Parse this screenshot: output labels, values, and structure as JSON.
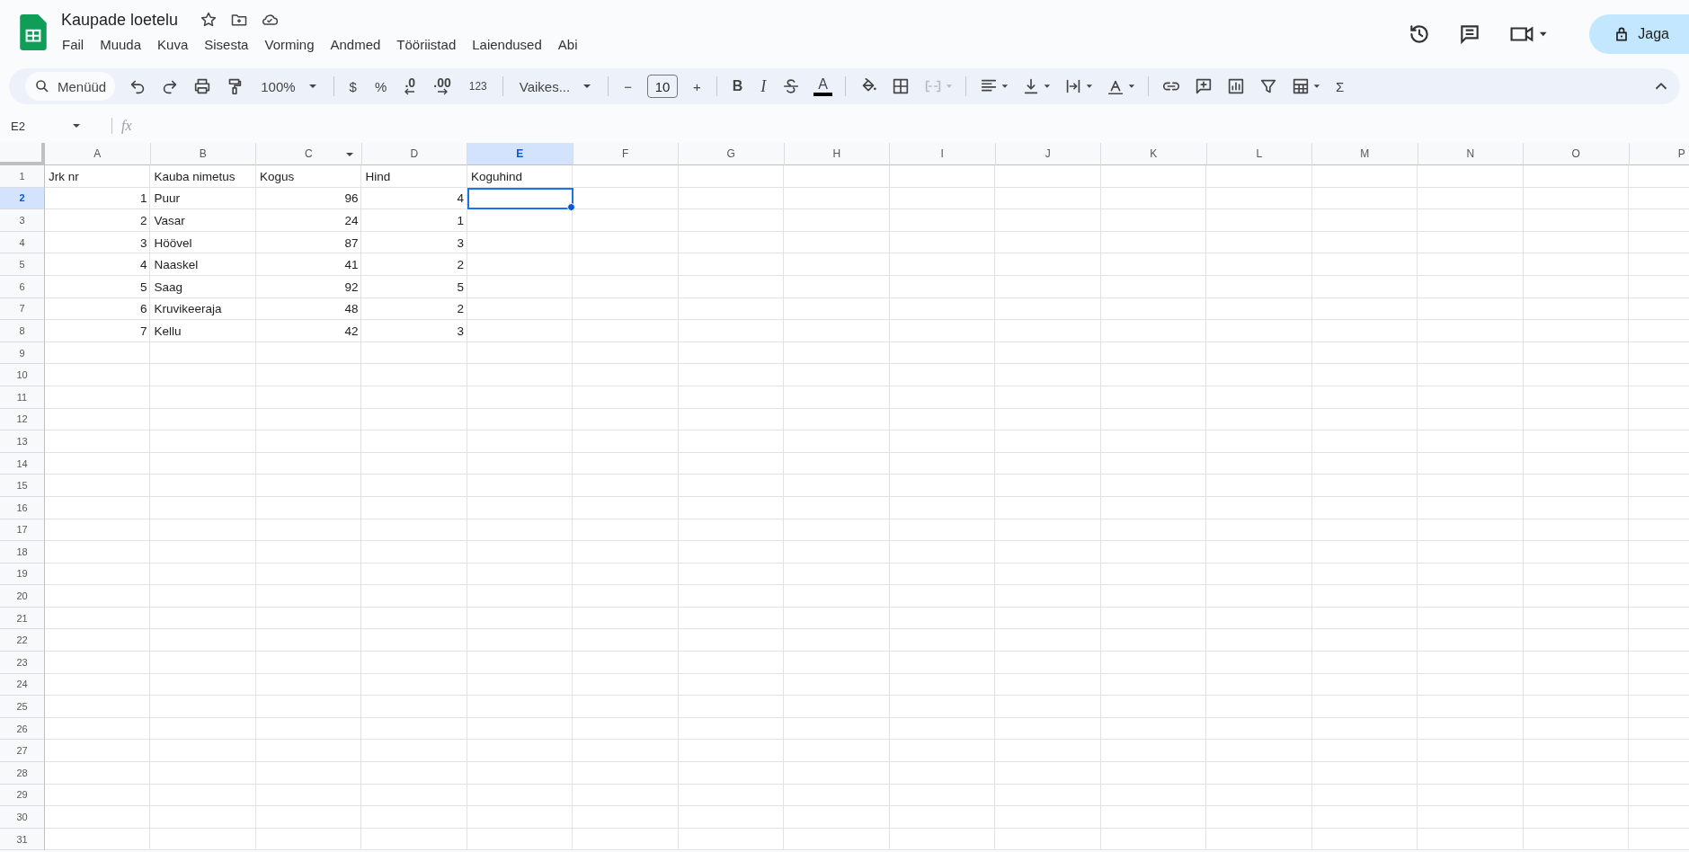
{
  "document": {
    "title": "Kaupade loetelu"
  },
  "menu": [
    "Fail",
    "Muuda",
    "Kuva",
    "Sisesta",
    "Vorming",
    "Andmed",
    "Tööriistad",
    "Laiendused",
    "Abi"
  ],
  "share_button": {
    "label": "Jaga"
  },
  "toolbar": [
    {
      "kind": "search",
      "text": "Menüüd"
    },
    {
      "kind": "undo",
      "disabled": false
    },
    {
      "kind": "redo",
      "disabled": false
    },
    {
      "kind": "print",
      "disabled": false
    },
    {
      "kind": "paint",
      "disabled": false
    },
    {
      "kind": "dropdown",
      "text": "100%"
    },
    {
      "kind": "sep"
    },
    {
      "kind": "glyph",
      "text": "$"
    },
    {
      "kind": "glyph",
      "text": "%"
    },
    {
      "kind": "decdecimal",
      "text": ".0"
    },
    {
      "kind": "incdecimal",
      "text": ".00"
    },
    {
      "kind": "small",
      "text": "123"
    },
    {
      "kind": "sep"
    },
    {
      "kind": "dropdown",
      "text": "Vaikes..."
    },
    {
      "kind": "sep"
    },
    {
      "kind": "glyph",
      "text": "−"
    },
    {
      "kind": "size",
      "text": "10"
    },
    {
      "kind": "glyph",
      "text": "+"
    },
    {
      "kind": "sep"
    },
    {
      "kind": "bold",
      "text": "B"
    },
    {
      "kind": "italic",
      "text": "I"
    },
    {
      "kind": "strike",
      "disabled": false
    },
    {
      "kind": "textcolor",
      "text": "A"
    },
    {
      "kind": "sep"
    },
    {
      "kind": "fill",
      "disabled": false
    },
    {
      "kind": "borders",
      "disabled": false
    },
    {
      "kind": "merge",
      "disabled": true
    },
    {
      "kind": "sep"
    },
    {
      "kind": "align",
      "disabled": false
    },
    {
      "kind": "valign",
      "disabled": false
    },
    {
      "kind": "wrap",
      "disabled": false
    },
    {
      "kind": "rotate",
      "disabled": false
    },
    {
      "kind": "sep"
    },
    {
      "kind": "link",
      "disabled": false
    },
    {
      "kind": "comment",
      "disabled": false
    },
    {
      "kind": "chart",
      "disabled": false
    },
    {
      "kind": "filter",
      "disabled": false
    },
    {
      "kind": "functions",
      "disabled": false
    },
    {
      "kind": "glyph",
      "text": "Σ"
    }
  ],
  "formula_bar": {
    "name_box": "E2",
    "fx": "fx"
  },
  "columns": [
    {
      "label": "A",
      "selected": false,
      "filter": false
    },
    {
      "label": "B",
      "selected": false,
      "filter": false
    },
    {
      "label": "C",
      "selected": false,
      "filter": true
    },
    {
      "label": "D",
      "selected": false,
      "filter": false
    },
    {
      "label": "E",
      "selected": true,
      "filter": false
    },
    {
      "label": "F",
      "selected": false,
      "filter": false
    },
    {
      "label": "G",
      "selected": false,
      "filter": false
    },
    {
      "label": "H",
      "selected": false,
      "filter": false
    },
    {
      "label": "I",
      "selected": false,
      "filter": false
    },
    {
      "label": "J",
      "selected": false,
      "filter": false
    },
    {
      "label": "K",
      "selected": false,
      "filter": false
    },
    {
      "label": "L",
      "selected": false,
      "filter": false
    },
    {
      "label": "M",
      "selected": false,
      "filter": false
    },
    {
      "label": "N",
      "selected": false,
      "filter": false
    },
    {
      "label": "O",
      "selected": false,
      "filter": false
    },
    {
      "label": "P",
      "selected": false,
      "filter": false
    }
  ],
  "rows": [
    {
      "number": "1",
      "selected": false,
      "cells": [
        {
          "text": "Jrk nr",
          "kind": "text",
          "selected": false
        },
        {
          "text": "Kauba nimetus",
          "kind": "text",
          "selected": false
        },
        {
          "text": "Kogus",
          "kind": "text",
          "selected": false
        },
        {
          "text": "Hind",
          "kind": "text",
          "selected": false
        },
        {
          "text": "Koguhind",
          "kind": "text",
          "selected": false
        }
      ]
    },
    {
      "number": "2",
      "selected": true,
      "cells": [
        {
          "text": "1",
          "kind": "number",
          "selected": false
        },
        {
          "text": "Puur",
          "kind": "text",
          "selected": false
        },
        {
          "text": "96",
          "kind": "number",
          "selected": false
        },
        {
          "text": "4",
          "kind": "number",
          "selected": false
        },
        {
          "selected": true
        }
      ]
    },
    {
      "number": "3",
      "selected": false,
      "cells": [
        {
          "text": "2",
          "kind": "number",
          "selected": false
        },
        {
          "text": "Vasar",
          "kind": "text",
          "selected": false
        },
        {
          "text": "24",
          "kind": "number",
          "selected": false
        },
        {
          "text": "1",
          "kind": "number",
          "selected": false
        }
      ]
    },
    {
      "number": "4",
      "selected": false,
      "cells": [
        {
          "text": "3",
          "kind": "number",
          "selected": false
        },
        {
          "text": "Höövel",
          "kind": "text",
          "selected": false
        },
        {
          "text": "87",
          "kind": "number",
          "selected": false
        },
        {
          "text": "3",
          "kind": "number",
          "selected": false
        }
      ]
    },
    {
      "number": "5",
      "selected": false,
      "cells": [
        {
          "text": "4",
          "kind": "number",
          "selected": false
        },
        {
          "text": "Naaskel",
          "kind": "text",
          "selected": false
        },
        {
          "text": "41",
          "kind": "number",
          "selected": false
        },
        {
          "text": "2",
          "kind": "number",
          "selected": false
        }
      ]
    },
    {
      "number": "6",
      "selected": false,
      "cells": [
        {
          "text": "5",
          "kind": "number",
          "selected": false
        },
        {
          "text": "Saag",
          "kind": "text",
          "selected": false
        },
        {
          "text": "92",
          "kind": "number",
          "selected": false
        },
        {
          "text": "5",
          "kind": "number",
          "selected": false
        }
      ]
    },
    {
      "number": "7",
      "selected": false,
      "cells": [
        {
          "text": "6",
          "kind": "number",
          "selected": false
        },
        {
          "text": "Kruvikeeraja",
          "kind": "text",
          "selected": false
        },
        {
          "text": "48",
          "kind": "number",
          "selected": false
        },
        {
          "text": "2",
          "kind": "number",
          "selected": false
        }
      ]
    },
    {
      "number": "8",
      "selected": false,
      "cells": [
        {
          "text": "7",
          "kind": "number",
          "selected": false
        },
        {
          "text": "Kellu",
          "kind": "text",
          "selected": false
        },
        {
          "text": "42",
          "kind": "number",
          "selected": false
        },
        {
          "text": "3",
          "kind": "number",
          "selected": false
        }
      ]
    },
    {
      "number": "9",
      "selected": false
    },
    {
      "number": "10",
      "selected": false
    },
    {
      "number": "11",
      "selected": false
    },
    {
      "number": "12",
      "selected": false
    },
    {
      "number": "13",
      "selected": false
    },
    {
      "number": "14",
      "selected": false
    },
    {
      "number": "15",
      "selected": false
    },
    {
      "number": "16",
      "selected": false
    },
    {
      "number": "17",
      "selected": false
    },
    {
      "number": "18",
      "selected": false
    },
    {
      "number": "19",
      "selected": false
    },
    {
      "number": "20",
      "selected": false
    },
    {
      "number": "21",
      "selected": false
    },
    {
      "number": "22",
      "selected": false
    },
    {
      "number": "23",
      "selected": false
    },
    {
      "number": "24",
      "selected": false
    },
    {
      "number": "25",
      "selected": false
    },
    {
      "number": "26",
      "selected": false
    },
    {
      "number": "27",
      "selected": false
    },
    {
      "number": "28",
      "selected": false
    },
    {
      "number": "29",
      "selected": false
    },
    {
      "number": "30",
      "selected": false
    },
    {
      "number": "31",
      "selected": false
    }
  ]
}
